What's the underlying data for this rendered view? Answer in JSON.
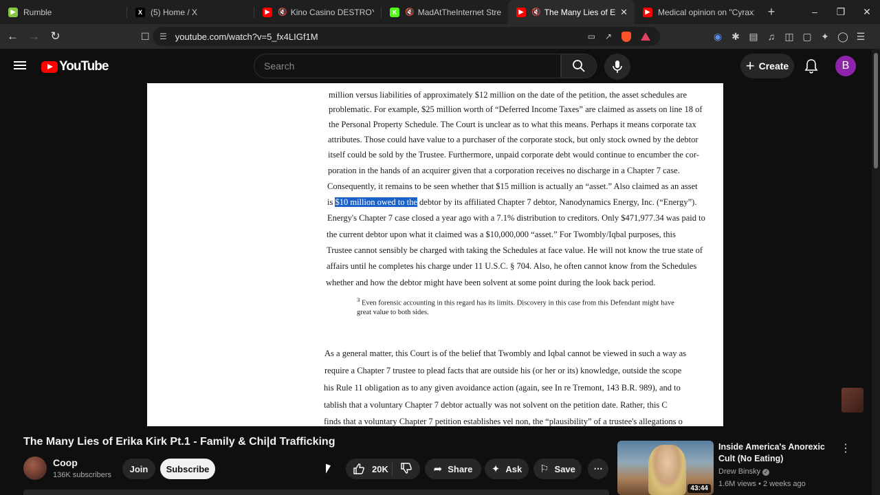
{
  "browser": {
    "tabs": [
      {
        "title": "Rumble",
        "favicon": "rumble-icon",
        "color": "#85c742",
        "muted": false
      },
      {
        "title": "(5) Home / X",
        "favicon": "x-icon",
        "color": "#000000",
        "muted": false
      },
      {
        "title": "Kino Casino DESTROYS DSP",
        "favicon": "youtube-icon",
        "color": "#ff0000",
        "muted": true
      },
      {
        "title": "MadAtTheInternet Stream -",
        "favicon": "kick-icon",
        "color": "#53fc18",
        "muted": true
      },
      {
        "title": "The Many Lies of Erika K",
        "favicon": "youtube-icon",
        "color": "#ff0000",
        "muted": true,
        "active": true
      },
      {
        "title": "Medical opinion on \"Cyraxx\"'s m",
        "favicon": "youtube-icon",
        "color": "#ff0000",
        "muted": false
      }
    ],
    "url": "youtube.com/watch?v=5_fx4LIGf1M"
  },
  "youtube": {
    "logo_text": "YouTube",
    "search_placeholder": "Search",
    "create_label": "Create",
    "avatar_letter": "B"
  },
  "document": {
    "lines": [
      "million versus liabilities of approximately $12 million on the date of the petition, the asset schedules are",
      "problematic. For example, $25 million worth of “Deferred Income Taxes” are claimed as assets on line 18 of",
      "the Personal Property Schedule. The Court is unclear as to what this means. Perhaps it means corporate tax",
      "attributes. Those could have value to a purchaser of the corporate stock, but only stock owned by the debtor",
      "itself could be sold by the Trustee. Furthermore, unpaid corporate debt would continue to encumber the cor-",
      "poration in the hands of an acquirer given that a corporation receives no discharge in a Chapter 7 case.",
      "Consequently, it remains to be seen whether that $15 million is actually an “asset.” Also claimed as an asset"
    ],
    "line8_prefix": "is ",
    "line8_highlight": "$10 million owed to the",
    "line8_suffix": " debtor by its affiliated Chapter 7 debtor, Nanodynamics Energy, Inc. (“Energy”).",
    "lines_b": [
      "Energy's Chapter 7 case closed a year ago with a 7.1% distribution to creditors. Only $471,977.34 was paid to",
      "the current debtor upon what it claimed was a $10,000,000 “asset.” For Twombly/Iqbal purposes, this",
      "Trustee cannot sensibly be charged with taking the Schedules at face value. He will not know the true state of",
      "affairs until he completes his charge under 11 U.S.C. § 704. Also, he often cannot know from the Schedules",
      "whether and how the debtor might have been solvent at some point during the look back period."
    ],
    "footnote_mark": "3",
    "footnote_line1": "Even forensic accounting in this regard has its limits. Discovery in this case from this Defendant might have",
    "footnote_line2": "great value to both sides.",
    "para2": [
      "As a general matter, this Court is of the belief that Twombly and Iqbal cannot be viewed in such a way as",
      "require a Chapter 7 trustee to plead facts that are outside his (or her or its) knowledge, outside the scope",
      "his Rule 11 obligation as to any given avoidance action (again, see In re Tremont, 143 B.R. 989), and to",
      "tablish that a voluntary Chapter 7 debtor actually was not solvent on the petition date. Rather, this C",
      "finds that a voluntary Chapter 7 petition establishes vel non, the “plausibility” of a trustee's allegations o"
    ]
  },
  "video": {
    "title": "The Many Lies of Erika Kirk Pt.1 - Family & Chi|d Trafficking",
    "channel": "Coop",
    "subscribers": "136K subscribers",
    "join_label": "Join",
    "subscribe_label": "Subscribe",
    "likes": "20K",
    "share_label": "Share",
    "ask_label": "Ask",
    "save_label": "Save"
  },
  "recommendation": {
    "title": "Inside America's Anorexic Cult (No Eating)",
    "channel": "Drew Binsky",
    "meta": "1.6M views • 2 weeks ago",
    "duration": "43:44"
  }
}
